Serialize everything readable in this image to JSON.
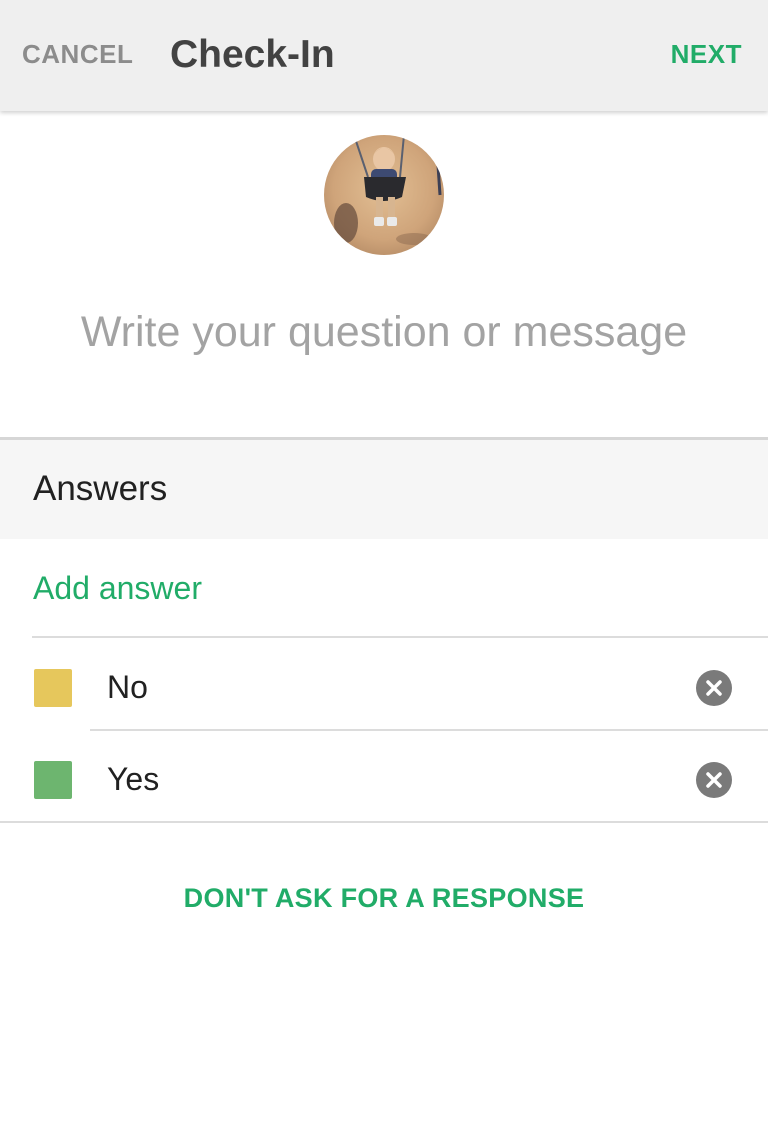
{
  "toolbar": {
    "cancel_label": "CANCEL",
    "title": "Check-In",
    "next_label": "NEXT"
  },
  "message": {
    "placeholder": "Write your question or message",
    "value": ""
  },
  "answers": {
    "header": "Answers",
    "add_label": "Add answer",
    "items": [
      {
        "label": "No",
        "color": "#e6c75c"
      },
      {
        "label": "Yes",
        "color": "#6db56f"
      }
    ]
  },
  "footer": {
    "dont_ask_label": "DON'T ASK FOR A RESPONSE"
  },
  "colors": {
    "accent": "#21ac68",
    "toolbar_bg": "#efefef",
    "header_bg": "#f6f6f6"
  },
  "icons": {
    "remove": "close-circle-icon",
    "avatar": "child-on-swing-photo"
  }
}
